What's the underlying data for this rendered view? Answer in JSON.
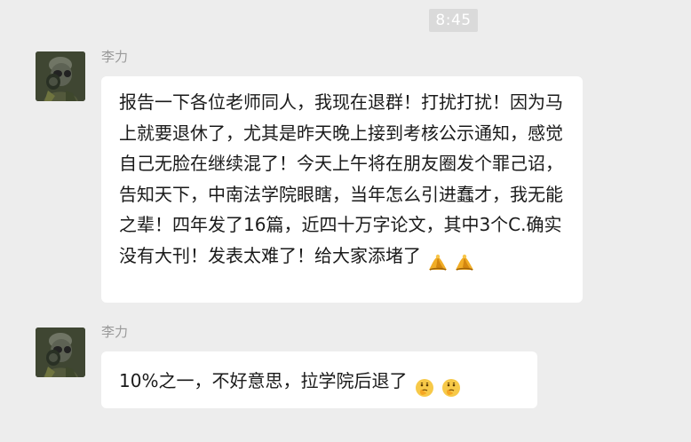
{
  "timestamp": "8:45",
  "messages": [
    {
      "sender": "李力",
      "text": "报告一下各位老师同人，我现在退群！打扰打扰！因为马上就要退休了，尤其是昨天晚上接到考核公示通知，感觉自己无脸在继续混了！今天上午将在朋友圈发个罪己诏，告知天下，中南法学院眼瞎，当年怎么引进蠢才，我无能之辈！四年发了16篇，近四十万字论文，其中3个C.确实没有大刊！发表太难了！给大家添堵了",
      "emojis": [
        "bow-emoji",
        "bow-emoji"
      ]
    },
    {
      "sender": "李力",
      "text": "10%之一，不好意思，拉学院后退了",
      "emojis": [
        "thinking-emoji",
        "thinking-emoji"
      ]
    }
  ]
}
